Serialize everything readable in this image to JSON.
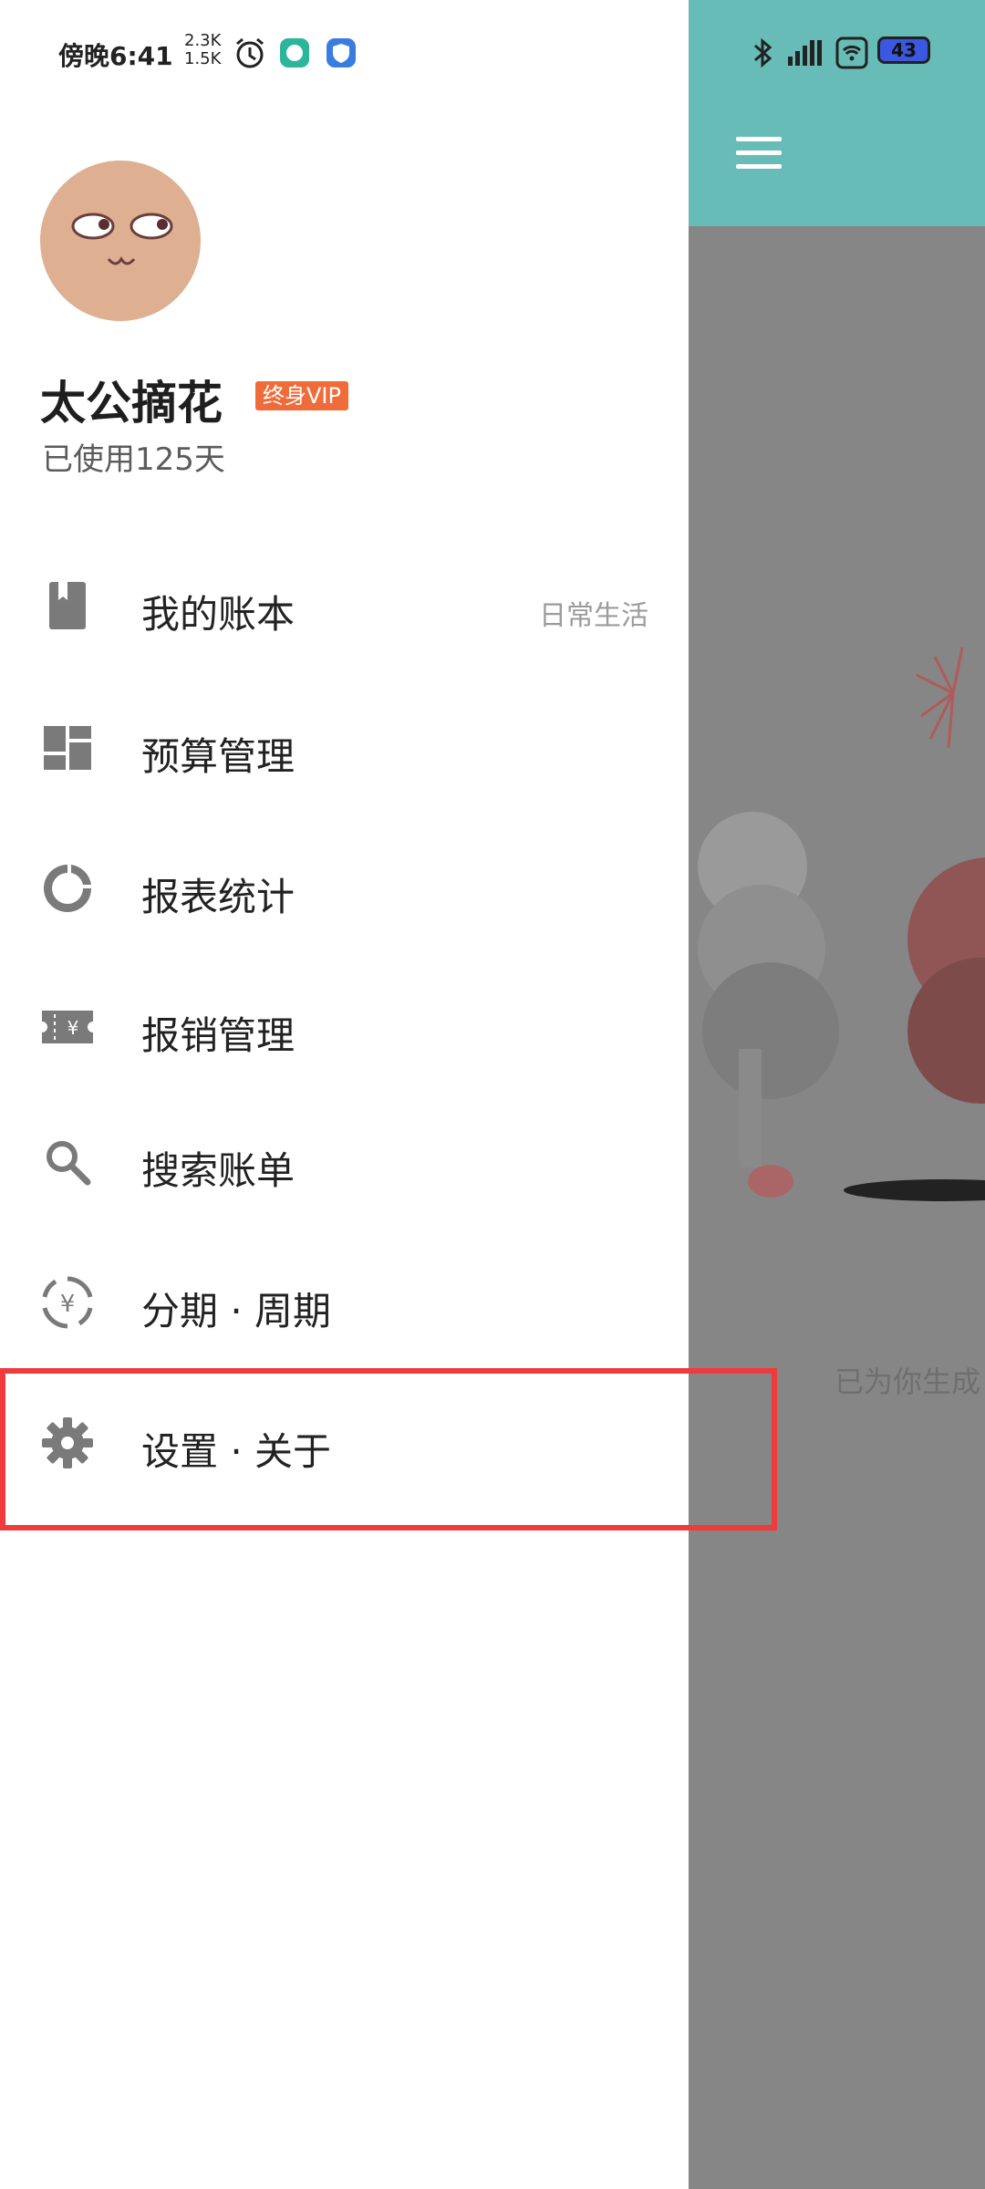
{
  "status_bar": {
    "time": "傍晚6:41",
    "net_up": "2.3K",
    "net_down": "1.5K",
    "battery": "43"
  },
  "profile": {
    "name": "太公摘花",
    "vip_badge": "终身VIP",
    "usage_days": "已使用125天"
  },
  "menu": {
    "items": [
      {
        "label": "我的账本",
        "sub": "日常生活",
        "icon": "book-icon"
      },
      {
        "label": "预算管理",
        "icon": "dashboard-icon"
      },
      {
        "label": "报表统计",
        "icon": "donut-chart-icon"
      },
      {
        "label": "报销管理",
        "icon": "ticket-yen-icon"
      },
      {
        "label": "搜索账单",
        "icon": "search-icon"
      },
      {
        "label": "分期 · 周期",
        "icon": "cycle-yen-icon"
      },
      {
        "label": "设置 · 关于",
        "icon": "gear-icon"
      }
    ]
  },
  "background_app": {
    "caption": "已为你生成"
  },
  "colors": {
    "header_teal": "#68bcb8",
    "scrim_gray": "#868686",
    "vip_orange": "#f06b3a",
    "highlight_red": "#ef3b3b",
    "icon_gray": "#7a7a7a"
  }
}
